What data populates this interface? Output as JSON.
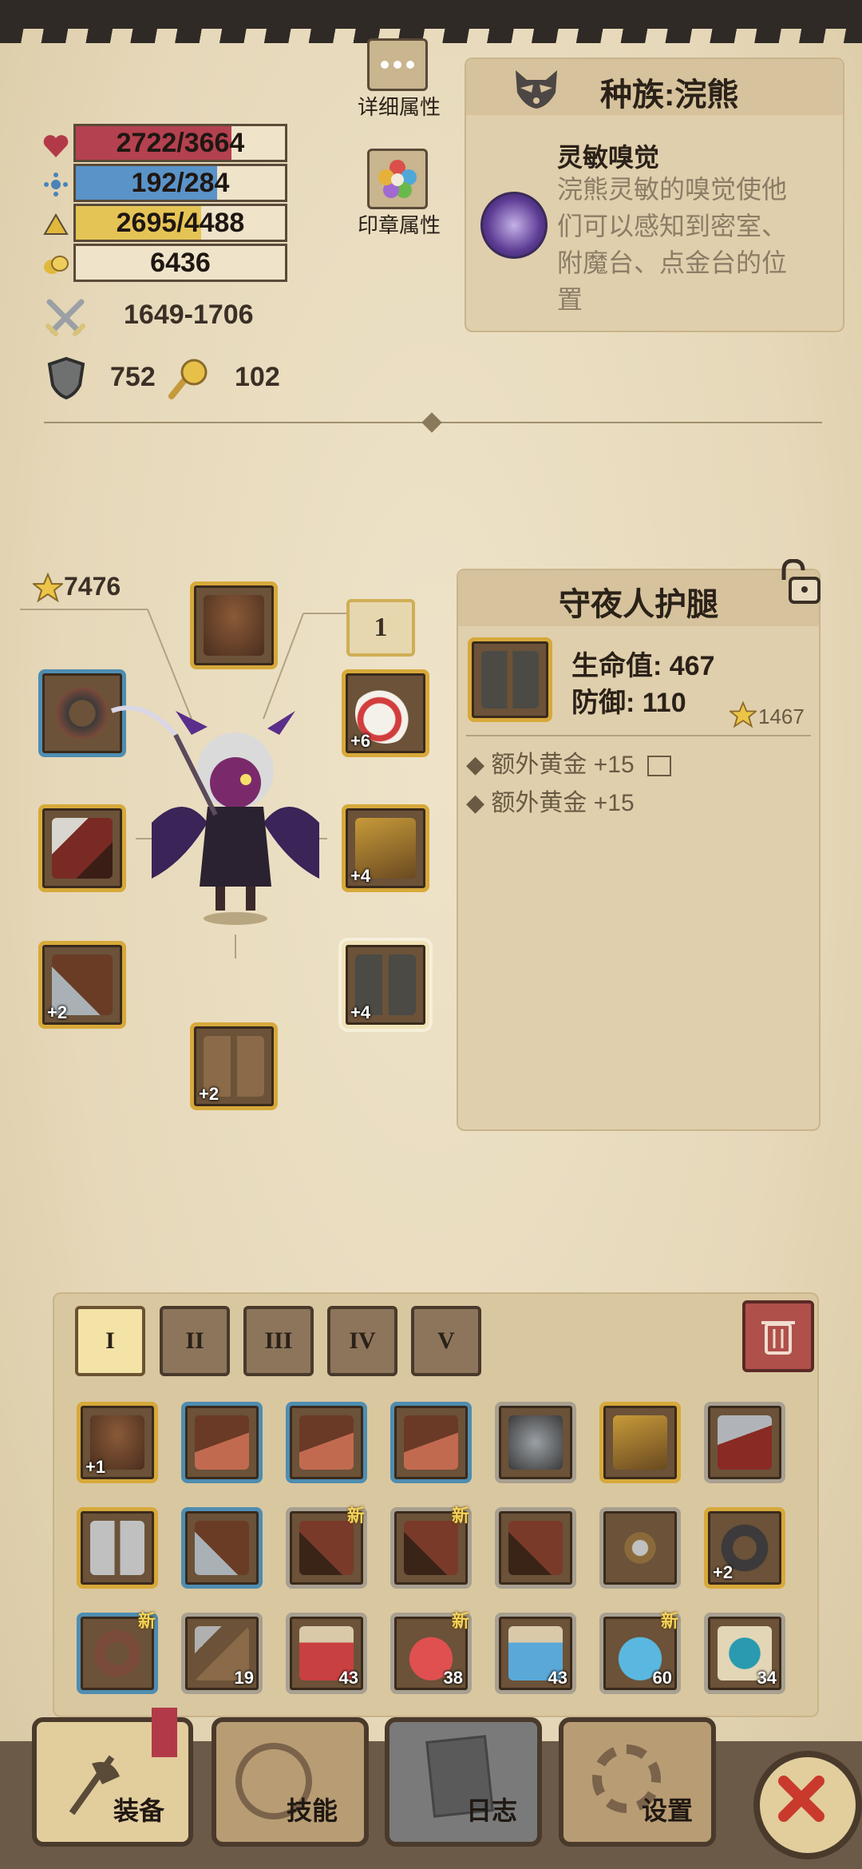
{
  "stats": {
    "hp": "2722/3664",
    "hp_ratio": 0.743,
    "mp": "192/284",
    "mp_ratio": 0.676,
    "xp": "2695/4488",
    "xp_ratio": 0.6,
    "gold": "6436",
    "attack": "1649-1706",
    "defense": "752",
    "luck": "102"
  },
  "top_buttons": {
    "detail_attributes": "详细属性",
    "seal_attributes": "印章属性"
  },
  "race": {
    "title": "种族:浣熊",
    "skill_name": "灵敏嗅觉",
    "skill_desc": "浣熊灵敏的嗅觉使他们可以感知到密室、附魔台、点金台的位置"
  },
  "character": {
    "score": "7476",
    "ring_slot_number": "1"
  },
  "equipment_slots": [
    {
      "name": "helmet",
      "level": ""
    },
    {
      "name": "ring",
      "level": ""
    },
    {
      "name": "amulet",
      "level": "+6"
    },
    {
      "name": "weapon",
      "level": ""
    },
    {
      "name": "armor",
      "level": "+4"
    },
    {
      "name": "gloves",
      "level": "+2"
    },
    {
      "name": "leggings",
      "level": "+4"
    },
    {
      "name": "boots",
      "level": "+2"
    }
  ],
  "item_detail": {
    "title": "守夜人护腿",
    "hp_stat": "生命值: 467",
    "def_stat": "防御: 110",
    "score": "1467",
    "bonus1": "额外黄金 +15",
    "bonus2": "额外黄金 +15"
  },
  "tabs": [
    "I",
    "II",
    "III",
    "IV",
    "V"
  ],
  "inventory": [
    {
      "name": "helmet",
      "level": "+1",
      "count": "",
      "new": "",
      "frame": "gold"
    },
    {
      "name": "hat",
      "level": "",
      "count": "",
      "new": "",
      "frame": "blue"
    },
    {
      "name": "hat",
      "level": "",
      "count": "",
      "new": "",
      "frame": "blue"
    },
    {
      "name": "hat",
      "level": "",
      "count": "",
      "new": "",
      "frame": "blue"
    },
    {
      "name": "iron-helm",
      "level": "",
      "count": "",
      "new": "",
      "frame": "gray"
    },
    {
      "name": "chest-armor",
      "level": "",
      "count": "",
      "new": "",
      "frame": "gold"
    },
    {
      "name": "shoulder-armor",
      "level": "",
      "count": "",
      "new": "",
      "frame": "gray"
    },
    {
      "name": "greaves",
      "level": "",
      "count": "",
      "new": "",
      "frame": "gold"
    },
    {
      "name": "gauntlet",
      "level": "",
      "count": "",
      "new": "",
      "frame": "blue"
    },
    {
      "name": "glove",
      "level": "",
      "count": "",
      "new": "新",
      "frame": "gray"
    },
    {
      "name": "glove",
      "level": "",
      "count": "",
      "new": "新",
      "frame": "gray"
    },
    {
      "name": "glove",
      "level": "",
      "count": "",
      "new": "",
      "frame": "gray"
    },
    {
      "name": "necklace",
      "level": "",
      "count": "",
      "new": "",
      "frame": "gray"
    },
    {
      "name": "ring",
      "level": "+2",
      "count": "",
      "new": "",
      "frame": "gold"
    },
    {
      "name": "belt-ring",
      "level": "",
      "count": "",
      "new": "新",
      "frame": "blue"
    },
    {
      "name": "pickaxe",
      "level": "",
      "count": "19",
      "new": "",
      "frame": "gray"
    },
    {
      "name": "red-potion-small",
      "level": "",
      "count": "43",
      "new": "",
      "frame": "gray"
    },
    {
      "name": "red-potion",
      "level": "",
      "count": "38",
      "new": "新",
      "frame": "gray"
    },
    {
      "name": "blue-potion-small",
      "level": "",
      "count": "43",
      "new": "",
      "frame": "gray"
    },
    {
      "name": "blue-potion",
      "level": "",
      "count": "60",
      "new": "新",
      "frame": "gray"
    },
    {
      "name": "scroll",
      "level": "",
      "count": "34",
      "new": "",
      "frame": "gray"
    }
  ],
  "nav": {
    "equipment": "装备",
    "skills": "技能",
    "log": "日志",
    "settings": "设置"
  },
  "colors": {
    "hp": "#b4414f",
    "mp": "#5a93c8",
    "xp": "#e5c456",
    "gold_frame": "#d7a93a",
    "blue_frame": "#4e8db1"
  }
}
